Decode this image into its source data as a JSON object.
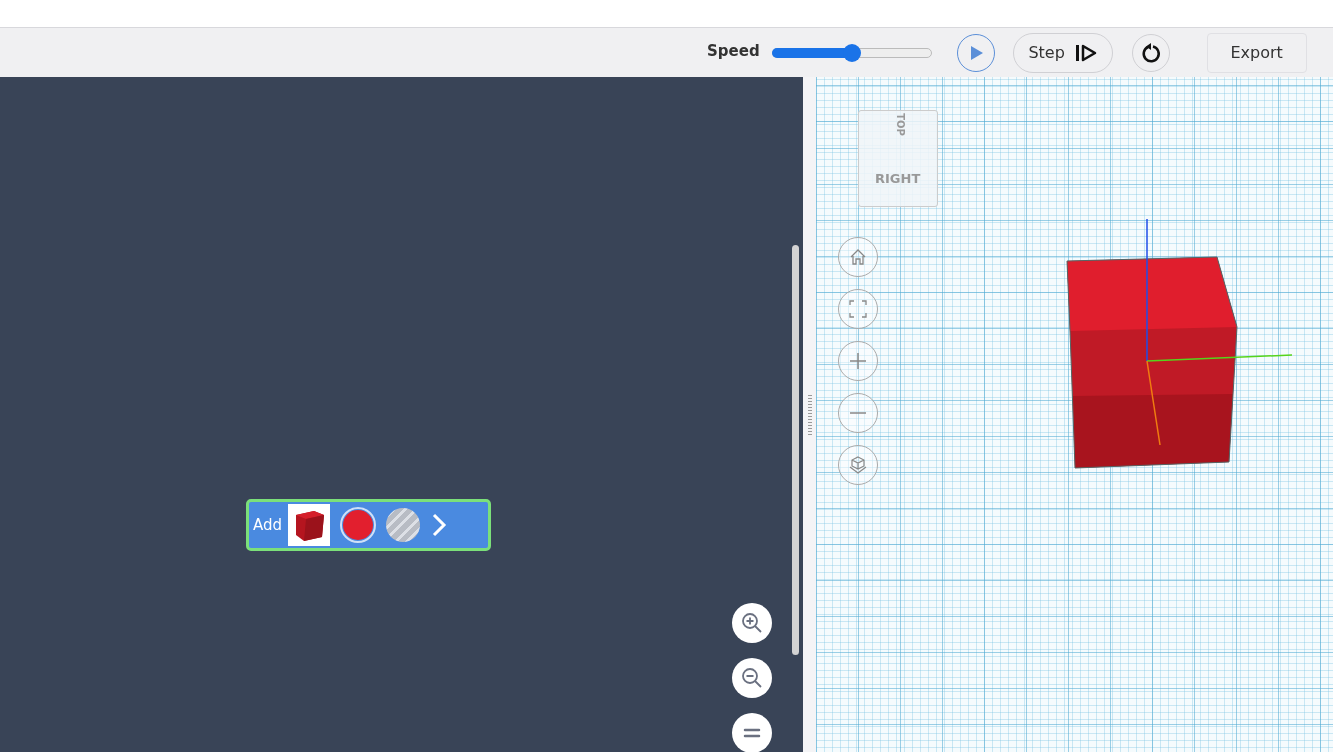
{
  "toolbar": {
    "speed": {
      "label": "Speed",
      "level": 0.5
    },
    "step_button": "Step",
    "export_button": "Export"
  },
  "code_panel": {
    "block": {
      "label": "Add",
      "color": "#e21f2e"
    }
  },
  "viewport": {
    "view_cube": {
      "top": "TOP",
      "right": "RIGHT"
    }
  }
}
